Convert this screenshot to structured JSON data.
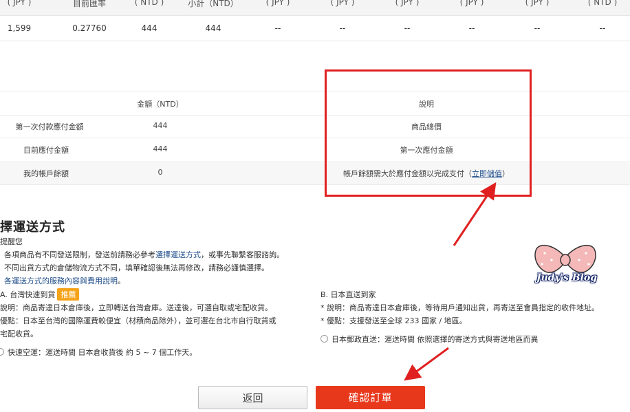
{
  "top_table": {
    "headers": [
      "( JPY )",
      "目前匯率",
      "( NTD )",
      "小計（NTD）",
      "( JPY )",
      "( JPY )",
      "( JPY )",
      "( JPY )",
      "( JPY )",
      "( NTD )"
    ],
    "values": [
      "1,599",
      "0.27760",
      "444",
      "444",
      "--",
      "--",
      "--",
      "--",
      "--",
      "--"
    ]
  },
  "summary": {
    "col_amount": "金額（NTD）",
    "col_desc": "說明",
    "rows": [
      {
        "label": "第一次付款應付金額",
        "amount": "444",
        "desc": "商品總價"
      },
      {
        "label": "目前應付金額",
        "amount": "444",
        "desc": "第一次應付金額"
      },
      {
        "label": "我的帳戶餘額",
        "amount": "0",
        "desc_prefix": "帳戶餘額需大於應付金額以完成支付（",
        "desc_link": "立即儲值",
        "desc_suffix": "）"
      }
    ]
  },
  "shipping": {
    "title": "擇運送方式",
    "reminder": "提醒您",
    "notes": [
      {
        "prefix": "各項商品有不同發送限制，發送前請務必參考",
        "link": "選擇運送方式",
        "suffix": "，或事先聯繫客服諮詢。"
      },
      {
        "text": "不同出貨方式的倉儲物流方式不同，填單確認後無法再修改，請務必謹慎選擇。"
      },
      {
        "link": "各運送方式的服務內容與費用說明",
        "suffix": "。"
      }
    ],
    "option_a": {
      "title": "A. 台灣快速到貨",
      "badge": "推薦",
      "desc1": "說明：商品寄達日本倉庫後，立即轉送台灣倉庫。送達後，可選自取或宅配收貨。",
      "desc2a": "優點：日本至台灣的國際運費較便宜（材積商品除外），並可選在台北市自行取貨或",
      "desc2b": "宅配收貨。",
      "radio_label": "快速空運：運送時間 日本倉收貨後 約 5 ~ 7 個工作天。"
    },
    "option_b": {
      "title": "B. 日本直送到家",
      "desc1": "* 說明：商品寄達日本倉庫後，等待用戶通知出貨，再寄送至會員指定的收件地址。",
      "desc2": "* 優點：支援發送至全球 233 國家 / 地區。",
      "radio_label": "日本郵政直送：運送時間 依照選擇的寄送方式與寄送地區而異"
    }
  },
  "buttons": {
    "back": "返回",
    "confirm": "確認訂單"
  },
  "watermark": "Judy's Blog",
  "colors": {
    "accent_red": "#e8381c",
    "highlight_box": "#e02020",
    "badge": "#f5a31a",
    "link": "#1f4e8a"
  }
}
